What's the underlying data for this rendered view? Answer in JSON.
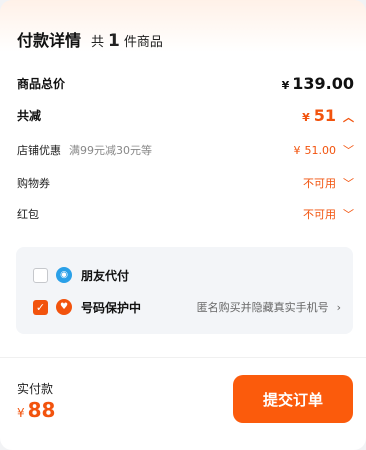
{
  "header": {
    "title": "付款详情",
    "count_prefix": "共",
    "count": "1",
    "count_suffix": "件商品"
  },
  "summary": {
    "total_label": "商品总价",
    "total_currency": "¥",
    "total_amount": "139.00",
    "reduce_label": "共减",
    "reduce_currency": "¥",
    "reduce_amount": "51"
  },
  "discounts": [
    {
      "label": "店铺优惠",
      "sub": "满99元减30元等",
      "currency": "¥",
      "value": "51.00"
    },
    {
      "label": "购物券",
      "value": "不可用"
    },
    {
      "label": "红包",
      "value": "不可用"
    }
  ],
  "options": [
    {
      "label": "朋友代付",
      "checked": false,
      "icon": "friend-pay-icon"
    },
    {
      "label": "号码保护中",
      "checked": true,
      "icon": "shield-icon",
      "detail": "匿名购买并隐藏真实手机号"
    }
  ],
  "footer": {
    "label": "实付款",
    "currency": "¥",
    "amount": "88",
    "submit_label": "提交订单"
  },
  "colors": {
    "accent": "#f2530d",
    "button": "#fb5b0c",
    "option_bg": "#f3f5f8"
  }
}
